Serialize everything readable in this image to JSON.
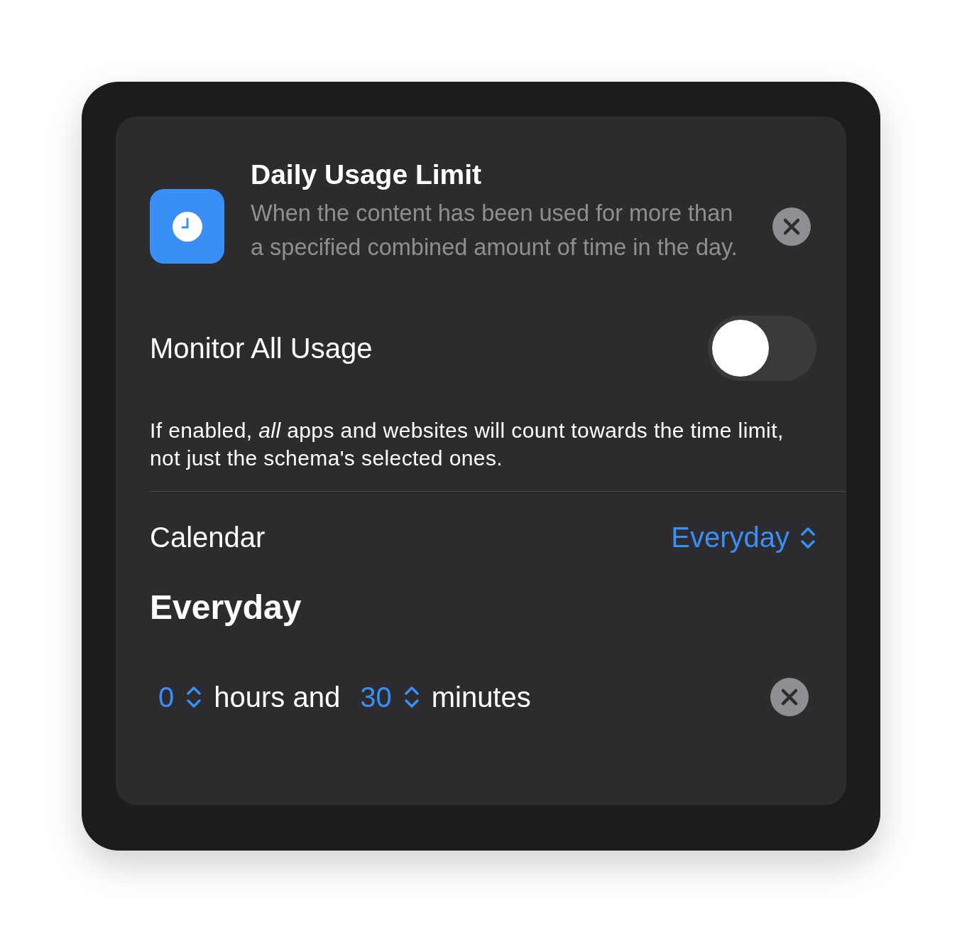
{
  "header": {
    "title": "Daily Usage Limit",
    "description": "When the content has been used for more than a specified combined amount of time in the day."
  },
  "monitor_all_usage": {
    "label": "Monitor All Usage",
    "on": false
  },
  "note": "If enabled, *all* apps and websites will count towards the time limit, not just the schema's selected ones.",
  "calendar": {
    "label": "Calendar",
    "value": "Everyday"
  },
  "schedule": {
    "title": "Everyday",
    "hours": "0",
    "hours_label": "hours and",
    "minutes": "30",
    "minutes_label": "minutes"
  }
}
